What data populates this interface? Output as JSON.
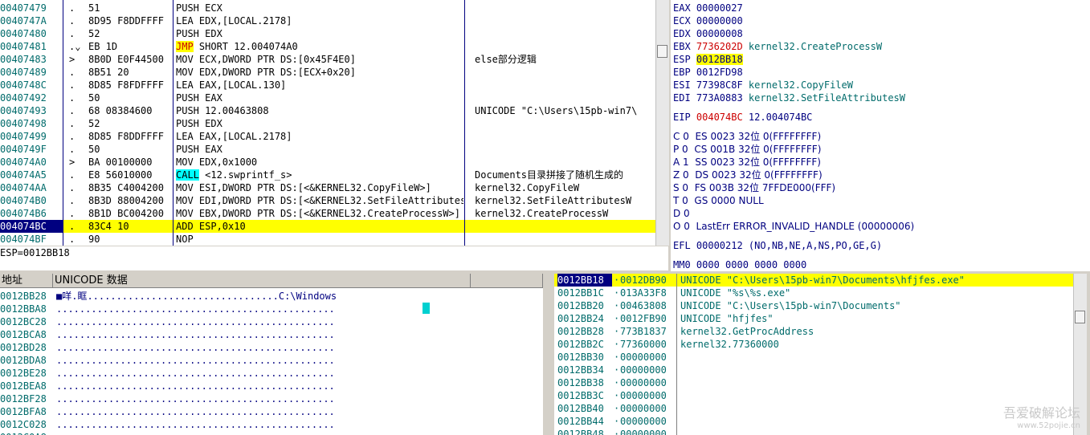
{
  "disasm": {
    "rows": [
      {
        "addr": "00407479",
        "mark": ".",
        "hex": "51",
        "asm": "PUSH ECX",
        "comment": ""
      },
      {
        "addr": "0040747A",
        "mark": ".",
        "hex": "8D95 F8DDFFFF",
        "asm": "LEA EDX,[LOCAL.2178]",
        "comment": ""
      },
      {
        "addr": "00407480",
        "mark": ".",
        "hex": "52",
        "asm": "PUSH EDX",
        "comment": ""
      },
      {
        "addr": "00407481",
        "mark": ".⌄",
        "hex": "EB 1D",
        "asm_kw": "JMP",
        "asm_rest": " SHORT 12.004074A0",
        "comment": ""
      },
      {
        "addr": "00407483",
        "mark": ">",
        "hex": "8B0D E0F44500",
        "asm": "MOV ECX,DWORD PTR DS:[0x45F4E0]",
        "comment": "else部分逻辑"
      },
      {
        "addr": "00407489",
        "mark": ".",
        "hex": "8B51 20",
        "asm": "MOV EDX,DWORD PTR DS:[ECX+0x20]",
        "comment": ""
      },
      {
        "addr": "0040748C",
        "mark": ".",
        "hex": "8D85 F8FDFFFF",
        "asm": "LEA EAX,[LOCAL.130]",
        "comment": ""
      },
      {
        "addr": "00407492",
        "mark": ".",
        "hex": "50",
        "asm": "PUSH EAX",
        "comment": ""
      },
      {
        "addr": "00407493",
        "mark": ".",
        "hex": "68 08384600",
        "asm": "PUSH 12.00463808",
        "comment": "UNICODE \"C:\\Users\\15pb-win7\\"
      },
      {
        "addr": "00407498",
        "mark": ".",
        "hex": "52",
        "asm": "PUSH EDX",
        "comment": ""
      },
      {
        "addr": "00407499",
        "mark": ".",
        "hex": "8D85 F8DDFFFF",
        "asm": "LEA EAX,[LOCAL.2178]",
        "comment": ""
      },
      {
        "addr": "0040749F",
        "mark": ".",
        "hex": "50",
        "asm": "PUSH EAX",
        "comment": ""
      },
      {
        "addr": "004074A0",
        "mark": ">",
        "hex": "BA 00100000",
        "asm": "MOV EDX,0x1000",
        "comment": ""
      },
      {
        "addr": "004074A5",
        "mark": ".",
        "hex": "E8 56010000",
        "asm_kw": "CALL",
        "asm_rest": " <12.swprintf_s>",
        "comment": "Documents目录拼接了随机生成的"
      },
      {
        "addr": "004074AA",
        "mark": ".",
        "hex": "8B35 C4004200",
        "asm": "MOV ESI,DWORD PTR DS:[<&KERNEL32.CopyFileW>]",
        "comment": "kernel32.CopyFileW"
      },
      {
        "addr": "004074B0",
        "mark": ".",
        "hex": "8B3D 88004200",
        "asm": "MOV EDI,DWORD PTR DS:[<&KERNEL32.SetFileAttributesW>]",
        "comment": "kernel32.SetFileAttributesW"
      },
      {
        "addr": "004074B6",
        "mark": ".",
        "hex": "8B1D BC004200",
        "asm": "MOV EBX,DWORD PTR DS:[<&KERNEL32.CreateProcessW>]",
        "comment": "kernel32.CreateProcessW"
      },
      {
        "addr": "004074BC",
        "mark": ".",
        "hex": "83C4 10",
        "asm": "ADD ESP,0x10",
        "comment": "",
        "current": true
      },
      {
        "addr": "004074BF",
        "mark": ".",
        "hex": "90",
        "asm": "NOP",
        "comment": ""
      }
    ]
  },
  "info_line": "ESP=0012BB18",
  "registers": {
    "gp": [
      {
        "name": "EAX",
        "value": "00000027",
        "note": ""
      },
      {
        "name": "ECX",
        "value": "00000000",
        "note": ""
      },
      {
        "name": "EDX",
        "value": "00000008",
        "note": ""
      },
      {
        "name": "EBX",
        "value": "7736202D",
        "note": "kernel32.CreateProcessW",
        "changed": true
      },
      {
        "name": "ESP",
        "value": "0012BB18",
        "note": "",
        "highlight": true
      },
      {
        "name": "EBP",
        "value": "0012FD98",
        "note": ""
      },
      {
        "name": "ESI",
        "value": "77398C8F",
        "note": "kernel32.CopyFileW"
      },
      {
        "name": "EDI",
        "value": "773A0883",
        "note": "kernel32.SetFileAttributesW"
      }
    ],
    "eip": {
      "name": "EIP",
      "value": "004074BC",
      "note": "12.004074BC"
    },
    "flags": [
      "C 0  ES 0023 32位 0(FFFFFFFF)",
      "P 0  CS 001B 32位 0(FFFFFFFF)",
      "A 1  SS 0023 32位 0(FFFFFFFF)",
      "Z 0  DS 0023 32位 0(FFFFFFFF)",
      "S 0  FS 003B 32位 7FFDE000(FFF)",
      "T 0  GS 0000 NULL",
      "D 0",
      "O 0  LastErr ERROR_INVALID_HANDLE (00000006)"
    ],
    "efl": "EFL 00000212 (NO,NB,NE,A,NS,PO,GE,G)",
    "mm0": "MM0 0000 0000 0000 0000"
  },
  "dump": {
    "header_addr": "地址",
    "header_data": "UNICODE 数据",
    "rows": [
      {
        "addr": "0012BB28",
        "data": "■咩.眶.................................C:\\Windows"
      },
      {
        "addr": "0012BBA8",
        "data": "................................................"
      },
      {
        "addr": "0012BC28",
        "data": "................................................"
      },
      {
        "addr": "0012BCA8",
        "data": "................................................"
      },
      {
        "addr": "0012BD28",
        "data": "................................................"
      },
      {
        "addr": "0012BDA8",
        "data": "................................................"
      },
      {
        "addr": "0012BE28",
        "data": "................................................"
      },
      {
        "addr": "0012BEA8",
        "data": "................................................"
      },
      {
        "addr": "0012BF28",
        "data": "................................................"
      },
      {
        "addr": "0012BFA8",
        "data": "................................................"
      },
      {
        "addr": "0012C028",
        "data": "................................................"
      },
      {
        "addr": "0012C0A8",
        "data": "................................................"
      }
    ]
  },
  "stack": {
    "rows": [
      {
        "addr": "0012BB18",
        "value": "0012DB90",
        "comment": "UNICODE \"C:\\Users\\15pb-win7\\Documents\\hfjfes.exe\"",
        "current": true
      },
      {
        "addr": "0012BB1C",
        "value": "013A33F8",
        "comment": "UNICODE \"%s\\%s.exe\""
      },
      {
        "addr": "0012BB20",
        "value": "00463808",
        "comment": "UNICODE \"C:\\Users\\15pb-win7\\Documents\""
      },
      {
        "addr": "0012BB24",
        "value": "0012FB90",
        "comment": "UNICODE \"hfjfes\""
      },
      {
        "addr": "0012BB28",
        "value": "773B1837",
        "comment": "kernel32.GetProcAddress"
      },
      {
        "addr": "0012BB2C",
        "value": "77360000",
        "comment": "kernel32.77360000"
      },
      {
        "addr": "0012BB30",
        "value": "00000000",
        "comment": ""
      },
      {
        "addr": "0012BB34",
        "value": "00000000",
        "comment": ""
      },
      {
        "addr": "0012BB38",
        "value": "00000000",
        "comment": ""
      },
      {
        "addr": "0012BB3C",
        "value": "00000000",
        "comment": ""
      },
      {
        "addr": "0012BB40",
        "value": "00000000",
        "comment": ""
      },
      {
        "addr": "0012BB44",
        "value": "00000000",
        "comment": ""
      },
      {
        "addr": "0012BB48",
        "value": "00000000",
        "comment": ""
      }
    ]
  },
  "watermark": {
    "line1": "吾爱破解论坛",
    "line2": "www.52pojie.cn"
  }
}
